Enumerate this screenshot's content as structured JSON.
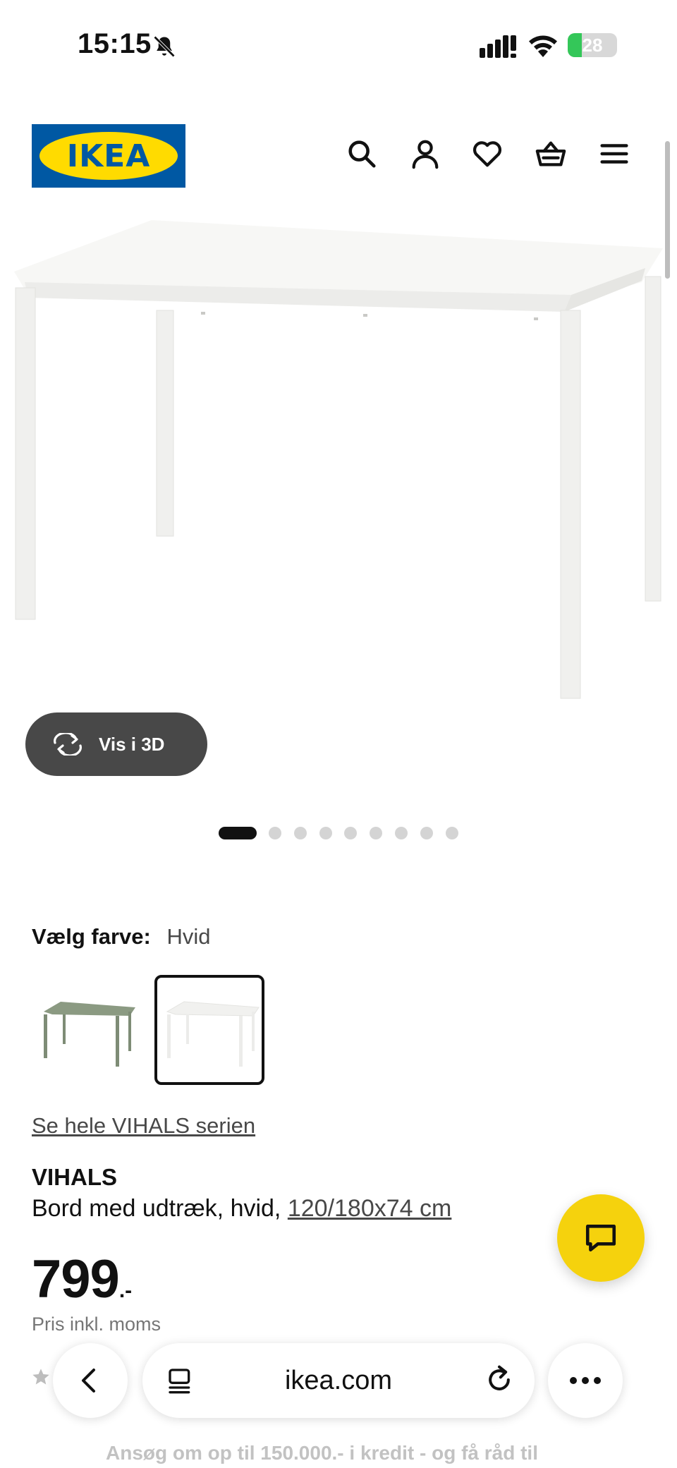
{
  "status_bar": {
    "time": "15:15",
    "battery_level": "28",
    "icons": [
      "bell-slash-icon",
      "cellular-signal-icon",
      "wifi-icon",
      "battery-charging-icon"
    ]
  },
  "header": {
    "logo_text": "IKEA",
    "icons": [
      "search-icon",
      "account-icon",
      "heart-icon",
      "basket-icon",
      "menu-icon"
    ],
    "colors": {
      "logo_blue": "#0058a3",
      "logo_yellow": "#ffdb00"
    }
  },
  "gallery": {
    "view_3d_label": "Vis i 3D",
    "image_count": 9,
    "active_index": 0
  },
  "color_selection": {
    "label": "Vælg farve:",
    "selected_value": "Hvid",
    "swatches": [
      {
        "name": "green",
        "color": "#8b9a82"
      },
      {
        "name": "white",
        "color": "#f4f4f2",
        "selected": true
      }
    ]
  },
  "product": {
    "series_link": "Se hele VIHALS serien",
    "name": "VIHALS",
    "description": "Bord med udtræk, hvid,",
    "dimensions": "120/180x74 cm",
    "price": "799",
    "price_suffix": ".-",
    "price_note": "Pris inkl. moms"
  },
  "credit_banner": "Ansøg om op til 150.000.- i kredit - og få råd til",
  "chat": {
    "icon": "chat-icon",
    "color": "#f5d20d"
  },
  "browser": {
    "url": "ikea.com",
    "icons": [
      "back-icon",
      "tabs-icon",
      "reload-icon",
      "more-icon"
    ]
  }
}
